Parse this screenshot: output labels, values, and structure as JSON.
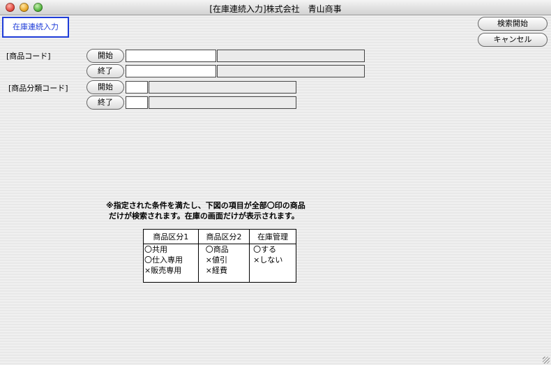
{
  "window": {
    "title": "[在庫連続入力]株式会社　青山商事"
  },
  "screen_label": "在庫連続入力",
  "buttons": {
    "search": "検索開始",
    "cancel": "キャンセル"
  },
  "product_code": {
    "label": "[商品コード]",
    "start_label": "開始",
    "end_label": "終了"
  },
  "category_code": {
    "label": "[商品分類コード]",
    "start_label": "開始",
    "end_label": "終了"
  },
  "note": {
    "line1": "※指定された条件を満たし、下図の項目が全部〇印の商品",
    "line2": "だけが検索されます。在庫の画面だけが表示されます。"
  },
  "legend": {
    "headers": [
      "商品区分1",
      "商品区分2",
      "在庫管理"
    ],
    "col1": [
      "〇共用",
      "〇仕入専用",
      "×販売専用"
    ],
    "col2": [
      "〇商品",
      "×値引",
      "×経費"
    ],
    "col3": [
      "〇する",
      "×しない"
    ]
  }
}
